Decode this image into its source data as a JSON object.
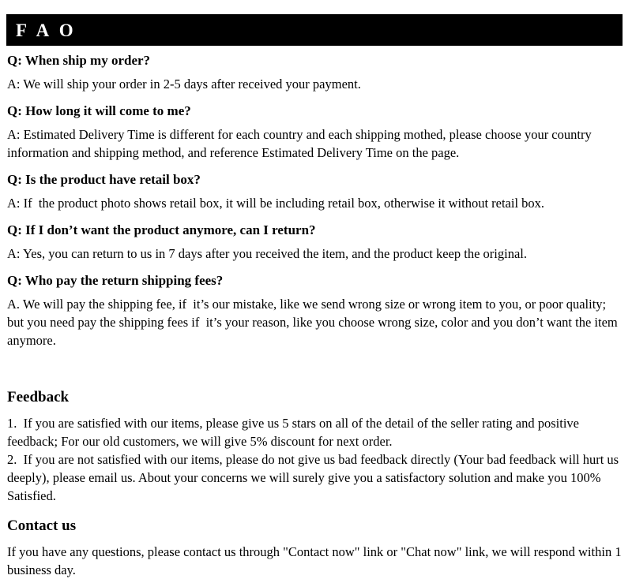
{
  "header": {
    "title": "F A O",
    "background_color": "#000000",
    "text_color": "#ffffff"
  },
  "faq": {
    "items": [
      {
        "question": "Q: When ship my order?",
        "answer": "A: We will ship your order in 2-5 days after received your payment."
      },
      {
        "question": "Q: How long it will come to me?",
        "answer": "A: Estimated Delivery Time is different for each country and each shipping mothed, please choose your country information and shipping method, and reference Estimated Delivery Time on the page."
      },
      {
        "question": "Q: Is the product have retail box?",
        "answer": "A: If  the product photo shows retail box, it will be including retail box, otherwise it without retail box."
      },
      {
        "question": "Q: If I don’t want the product anymore, can I return?",
        "answer": "A: Yes, you can return to us in 7 days after you received the item, and the product keep the original."
      },
      {
        "question": "Q: Who pay the return shipping fees?",
        "answer": "A. We will pay the shipping fee, if  it’s our mistake, like we send wrong size or wrong item to you, or poor quality; but you need pay the shipping fees if  it’s your reason, like you choose wrong size, color and you don’t want the item anymore."
      }
    ]
  },
  "feedback": {
    "heading": "Feedback",
    "paragraphs": [
      "1.  If you are satisfied with our items, please give us 5 stars on all of the detail of the seller rating and positive feedback; For our old customers, we will give 5% discount for next order.",
      "2.  If you are not satisfied with our items, please do not give us bad feedback directly (Your bad feedback will hurt us deeply), please email us. About your concerns we will surely give you a satisfactory solution and make you 100% Satisfied."
    ]
  },
  "contact": {
    "heading": "Contact us",
    "paragraph": "If you have any questions, please contact us through \"Contact now\" link or \"Chat now\" link, we will respond within 1 business day."
  }
}
